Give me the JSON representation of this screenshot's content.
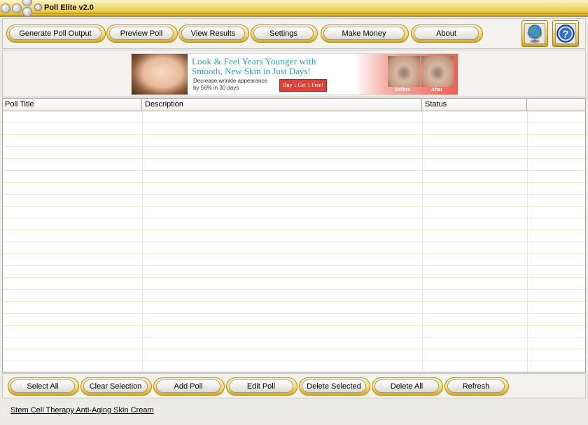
{
  "window": {
    "title": "Poll Elite v2.0"
  },
  "toolbar": {
    "buttons": [
      {
        "label": "Generate Poll Output"
      },
      {
        "label": "Preview Poll"
      },
      {
        "label": "View Results"
      },
      {
        "label": "Settings"
      },
      {
        "label": "Make Money"
      },
      {
        "label": "About"
      }
    ],
    "icons": [
      {
        "name": "globe-icon"
      },
      {
        "name": "help-icon"
      }
    ]
  },
  "ad": {
    "headline_line1": "Look & Feel Years Younger with",
    "headline_line2": "Smooth, New Skin in Just Days!",
    "sub_line1": "Decrease wrinkle appearance",
    "sub_line2": "by 56% in 30 days",
    "cta": "Buy 1 Get 1 Free!",
    "before_label": "Before",
    "after_label": "After"
  },
  "table": {
    "columns": [
      {
        "label": "Poll Title"
      },
      {
        "label": "Description"
      },
      {
        "label": "Status"
      },
      {
        "label": ""
      }
    ],
    "rows": []
  },
  "actions": {
    "buttons": [
      {
        "label": "Select All"
      },
      {
        "label": "Clear Selection"
      },
      {
        "label": "Add Poll"
      },
      {
        "label": "Edit Poll"
      },
      {
        "label": "Delete Selected"
      },
      {
        "label": "Delete All"
      },
      {
        "label": "Refresh"
      }
    ]
  },
  "footer": {
    "link": "Stem Cell Therapy Anti-Aging Skin Cream"
  }
}
